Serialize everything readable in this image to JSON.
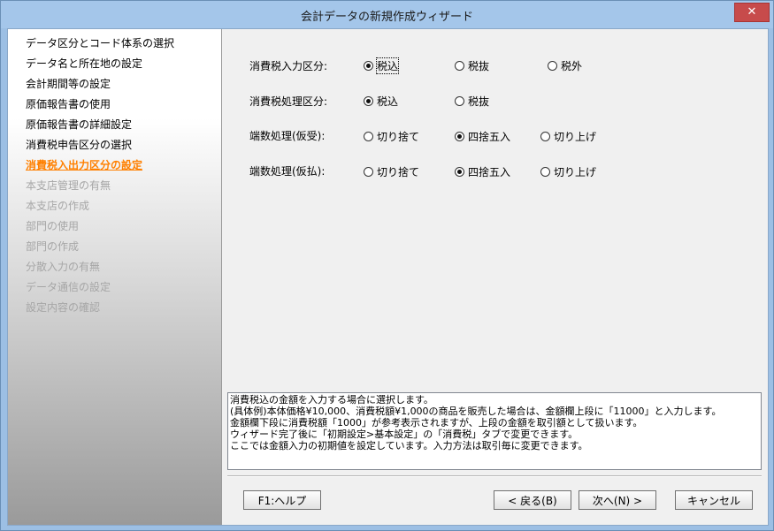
{
  "window": {
    "title": "会計データの新規作成ウィザード",
    "close_glyph": "✕"
  },
  "steps": [
    {
      "label": "データ区分とコード体系の選択",
      "state": "done"
    },
    {
      "label": "データ名と所在地の設定",
      "state": "done"
    },
    {
      "label": "会計期間等の設定",
      "state": "done"
    },
    {
      "label": "原価報告書の使用",
      "state": "done"
    },
    {
      "label": "原価報告書の詳細設定",
      "state": "done"
    },
    {
      "label": "消費税申告区分の選択",
      "state": "done"
    },
    {
      "label": "消費税入出力区分の設定",
      "state": "current"
    },
    {
      "label": "本支店管理の有無",
      "state": "todo"
    },
    {
      "label": "本支店の作成",
      "state": "todo"
    },
    {
      "label": "部門の使用",
      "state": "todo"
    },
    {
      "label": "部門の作成",
      "state": "todo"
    },
    {
      "label": "分散入力の有無",
      "state": "todo"
    },
    {
      "label": "データ通信の設定",
      "state": "todo"
    },
    {
      "label": "設定内容の確認",
      "state": "todo"
    }
  ],
  "settings": [
    {
      "label": "消費税入力区分:",
      "options": [
        "税込",
        "税抜",
        "税外"
      ],
      "selected": 0
    },
    {
      "label": "消費税処理区分:",
      "options": [
        "税込",
        "税抜"
      ],
      "selected": 0
    },
    {
      "label": "端数処理(仮受):",
      "options": [
        "切り捨て",
        "四捨五入",
        "切り上げ"
      ],
      "selected": 1
    },
    {
      "label": "端数処理(仮払):",
      "options": [
        "切り捨て",
        "四捨五入",
        "切り上げ"
      ],
      "selected": 1
    }
  ],
  "description": [
    "消費税込の金額を入力する場合に選択します。",
    "(具体例)本体価格¥10,000、消費税額¥1,000の商品を販売した場合は、金額欄上段に「11000」と入力します。",
    "金額欄下段に消費税額「1000」が参考表示されますが、上段の金額を取引額として扱います。",
    "ウィザード完了後に「初期設定>基本設定」の「消費税」タブで変更できます。",
    "ここでは金額入力の初期値を設定しています。入力方法は取引毎に変更できます。"
  ],
  "buttons": {
    "help": "F1:ヘルプ",
    "back": "< 戻る(B)",
    "next": "次へ(N) >",
    "cancel": "キャンセル"
  },
  "colors": {
    "current_step": "#ff8000",
    "todo_step": "#a6a6a6"
  }
}
